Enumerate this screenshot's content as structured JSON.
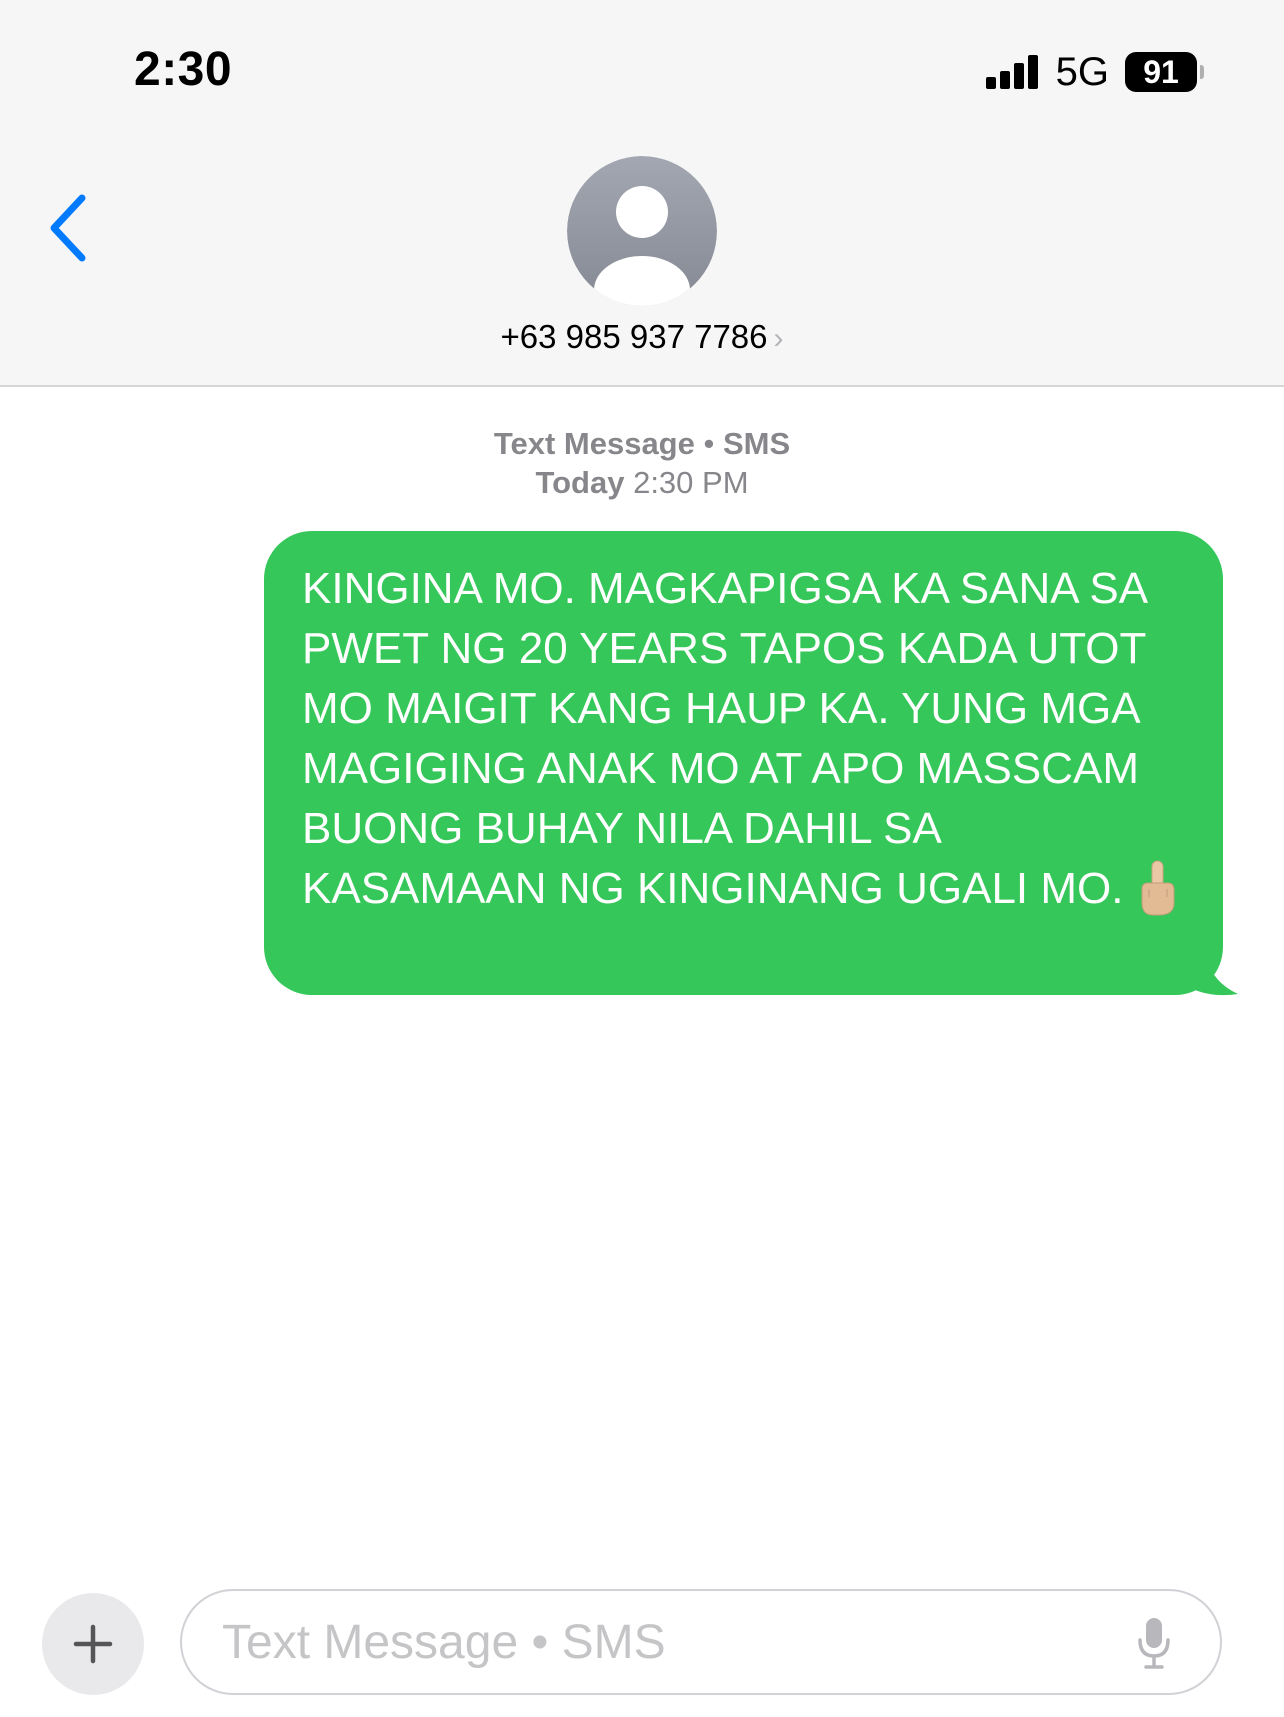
{
  "status_bar": {
    "time": "2:30",
    "network": "5G",
    "battery": "91"
  },
  "header": {
    "contact": "+63 985 937 7786",
    "contact_chevron": "›"
  },
  "thread": {
    "service_label": "Text Message",
    "service_type": "SMS",
    "day": "Today",
    "time": "2:30 PM"
  },
  "message": {
    "text": "KINGINA MO. MAGKAPIGSA KA SANA SA PWET NG 20 YEARS TAPOS KADA UTOT MO MAIGIT KANG HAUP KA. YUNG MGA MAGIGING ANAK MO AT APO MASSCAM BUONG BUHAY NILA DAHIL SA KASAMAAN NG KINGINANG UGALI MO.",
    "emoji": "middle-finger-emoji"
  },
  "composer": {
    "placeholder": "Text Message • SMS"
  },
  "icons": {
    "back": "chevron-left-icon",
    "avatar": "person-icon",
    "add": "plus-icon",
    "mic": "microphone-icon"
  },
  "colors": {
    "accent": "#007aff",
    "bubble": "#35c759",
    "header_bg": "#f6f6f6",
    "meta_text": "#86868b"
  }
}
